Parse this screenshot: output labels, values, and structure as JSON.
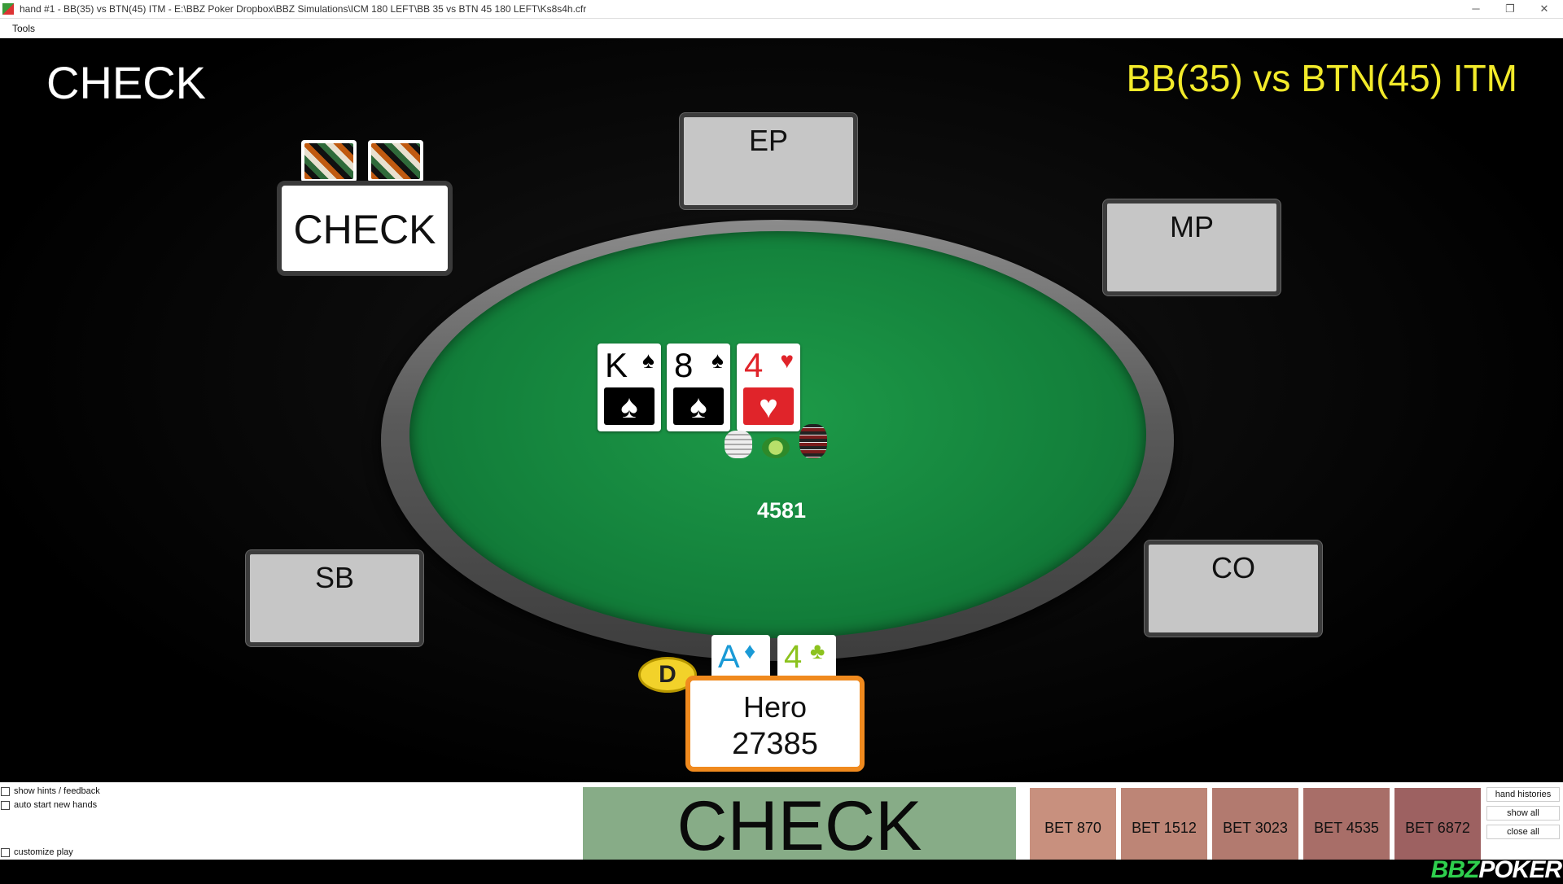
{
  "window": {
    "title": "hand #1 - BB(35) vs BTN(45) ITM - E:\\BBZ Poker Dropbox\\BBZ Simulations\\ICM 180 LEFT\\BB 35 vs BTN 45 180 LEFT\\Ks8s4h.cfr",
    "minimize": "─",
    "restore": "❐",
    "close": "✕"
  },
  "menu": {
    "tools": "Tools"
  },
  "header": {
    "action_title": "CHECK",
    "match_title": "BB(35) vs BTN(45) ITM"
  },
  "seats": {
    "ep": "EP",
    "mp": "MP",
    "co": "CO",
    "sb": "SB"
  },
  "villain": {
    "action": "CHECK"
  },
  "board": [
    {
      "rank": "K",
      "suit": "♠",
      "color": "#000000"
    },
    {
      "rank": "8",
      "suit": "♠",
      "color": "#000000"
    },
    {
      "rank": "4",
      "suit": "♥",
      "color": "#e0242a"
    }
  ],
  "pot": {
    "amount": "4581"
  },
  "dealer": {
    "label": "D"
  },
  "hero": {
    "name": "Hero",
    "stack": "27385",
    "cards": [
      {
        "rank": "A",
        "suit": "♦",
        "color": "#1a9ad6"
      },
      {
        "rank": "4",
        "suit": "♣",
        "color": "#8cc21e"
      }
    ]
  },
  "options": {
    "show_hints": "show hints / feedback",
    "auto_start": "auto start new hands",
    "customize": "customize play"
  },
  "actions": {
    "check": "CHECK",
    "bets": [
      {
        "label": "BET 870",
        "color": "#c8907e"
      },
      {
        "label": "BET 1512",
        "color": "#bd8576"
      },
      {
        "label": "BET 3023",
        "color": "#b27a6f"
      },
      {
        "label": "BET 4535",
        "color": "#a86e68"
      },
      {
        "label": "BET 6872",
        "color": "#9d6161"
      }
    ]
  },
  "side": {
    "hand_histories": "hand histories",
    "show_all": "show all",
    "close_all": "close all"
  },
  "brand": {
    "left": "BBZ",
    "right": "POKER"
  }
}
